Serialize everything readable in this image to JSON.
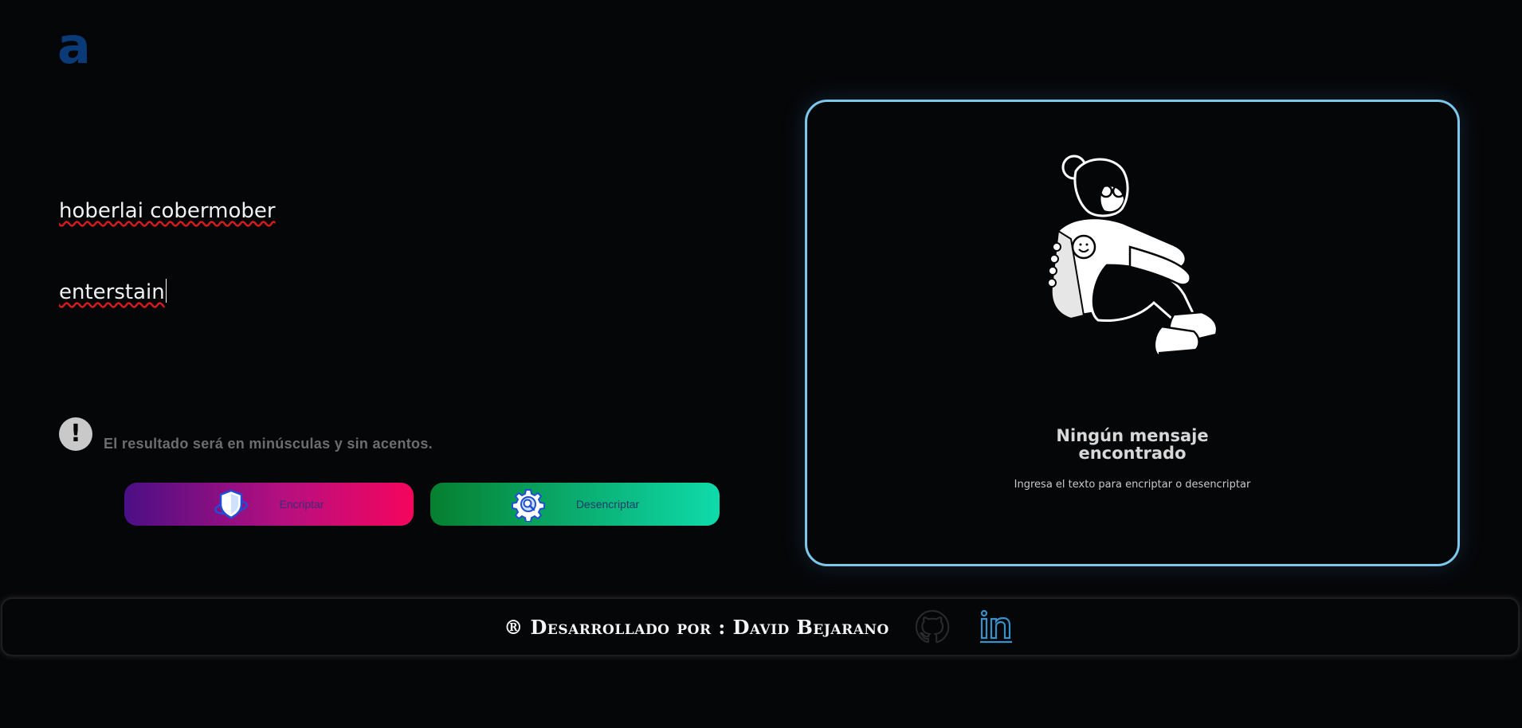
{
  "brand": {
    "logo_letter": "a",
    "logo_color": "#0b3a78"
  },
  "editor": {
    "lines": [
      "hoberlai cobermober",
      "enterstain"
    ]
  },
  "notice": {
    "icon": "exclamation-icon",
    "text": "El resultado será en minúsculas y sin acentos."
  },
  "buttons": {
    "encrypt": {
      "label": "Encriptar",
      "icon": "shield-icon"
    },
    "decrypt": {
      "label": "Desencriptar",
      "icon": "gear-search-icon"
    }
  },
  "output_panel": {
    "illustration": "girl-sitting-illustration",
    "title_line1": "Ningún mensaje",
    "title_line2": "encontrado",
    "subtitle": "Ingresa el texto para encriptar o desencriptar",
    "border_color": "#7cc8ec"
  },
  "footer": {
    "text": "® Desarrollado por : David Bejarano",
    "github_icon": "github-icon",
    "linkedin_icon": "linkedin-icon"
  },
  "colors": {
    "background": "#050608",
    "encrypt_gradient": [
      "#4b0f85",
      "#f5055d"
    ],
    "decrypt_gradient": [
      "#067f2f",
      "#0edbaa"
    ]
  }
}
